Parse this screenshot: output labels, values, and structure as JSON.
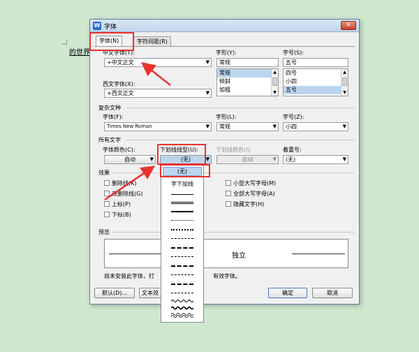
{
  "document": {
    "text": "的世界"
  },
  "dialog": {
    "title": "字体",
    "close": "✕",
    "tabs": [
      {
        "label": "字体(N)"
      },
      {
        "label": "字符间距(R)"
      }
    ]
  },
  "cjk_font": {
    "label": "中文字体(T):",
    "value": "+中文正文"
  },
  "western_font": {
    "label": "西文字体(X):",
    "value": "+西文正文"
  },
  "style": {
    "label": "字形(Y):",
    "value": "常规",
    "options": [
      "常规",
      "倾斜",
      "加粗"
    ]
  },
  "size": {
    "label": "字号(S):",
    "value": "五号",
    "options": [
      "四号",
      "小四",
      "五号"
    ]
  },
  "complex": {
    "section": "复杂文种",
    "font_label": "字体(F):",
    "font_value": "Times New Roman",
    "style_label": "字形(L):",
    "style_value": "常规",
    "size_label": "字号(Z):",
    "size_value": "小四"
  },
  "all_text": {
    "section": "所有文字",
    "color_label": "字体颜色(C):",
    "color_value": "自动",
    "underline_label": "下划线线型(U):",
    "underline_value": "(无)",
    "underline_color_label": "下划线颜色(I):",
    "underline_color_value": "自动",
    "emphasis_label": "着重号:",
    "emphasis_value": "(无)"
  },
  "effects": {
    "section": "效果",
    "left": [
      "删除线(K)",
      "双删除线(G)",
      "上标(P)",
      "下标(B)"
    ],
    "right": [
      "小型大写字母(M)",
      "全部大写字母(A)",
      "隐藏文字(H)"
    ]
  },
  "preview": {
    "section": "预览",
    "sample": "独立"
  },
  "note": "尚未安装此字体，打",
  "note_tail": "有效字体。",
  "buttons": {
    "default": "默认(D)...",
    "text_effect": "文本效",
    "ok": "确定",
    "cancel": "取消"
  },
  "dropdown": {
    "selected": "(无)",
    "label": "字下加线"
  },
  "colors": {
    "annotation_red": "#e8322e",
    "titlebar": "#c2d6ee",
    "selection": "#bcd5ef"
  }
}
